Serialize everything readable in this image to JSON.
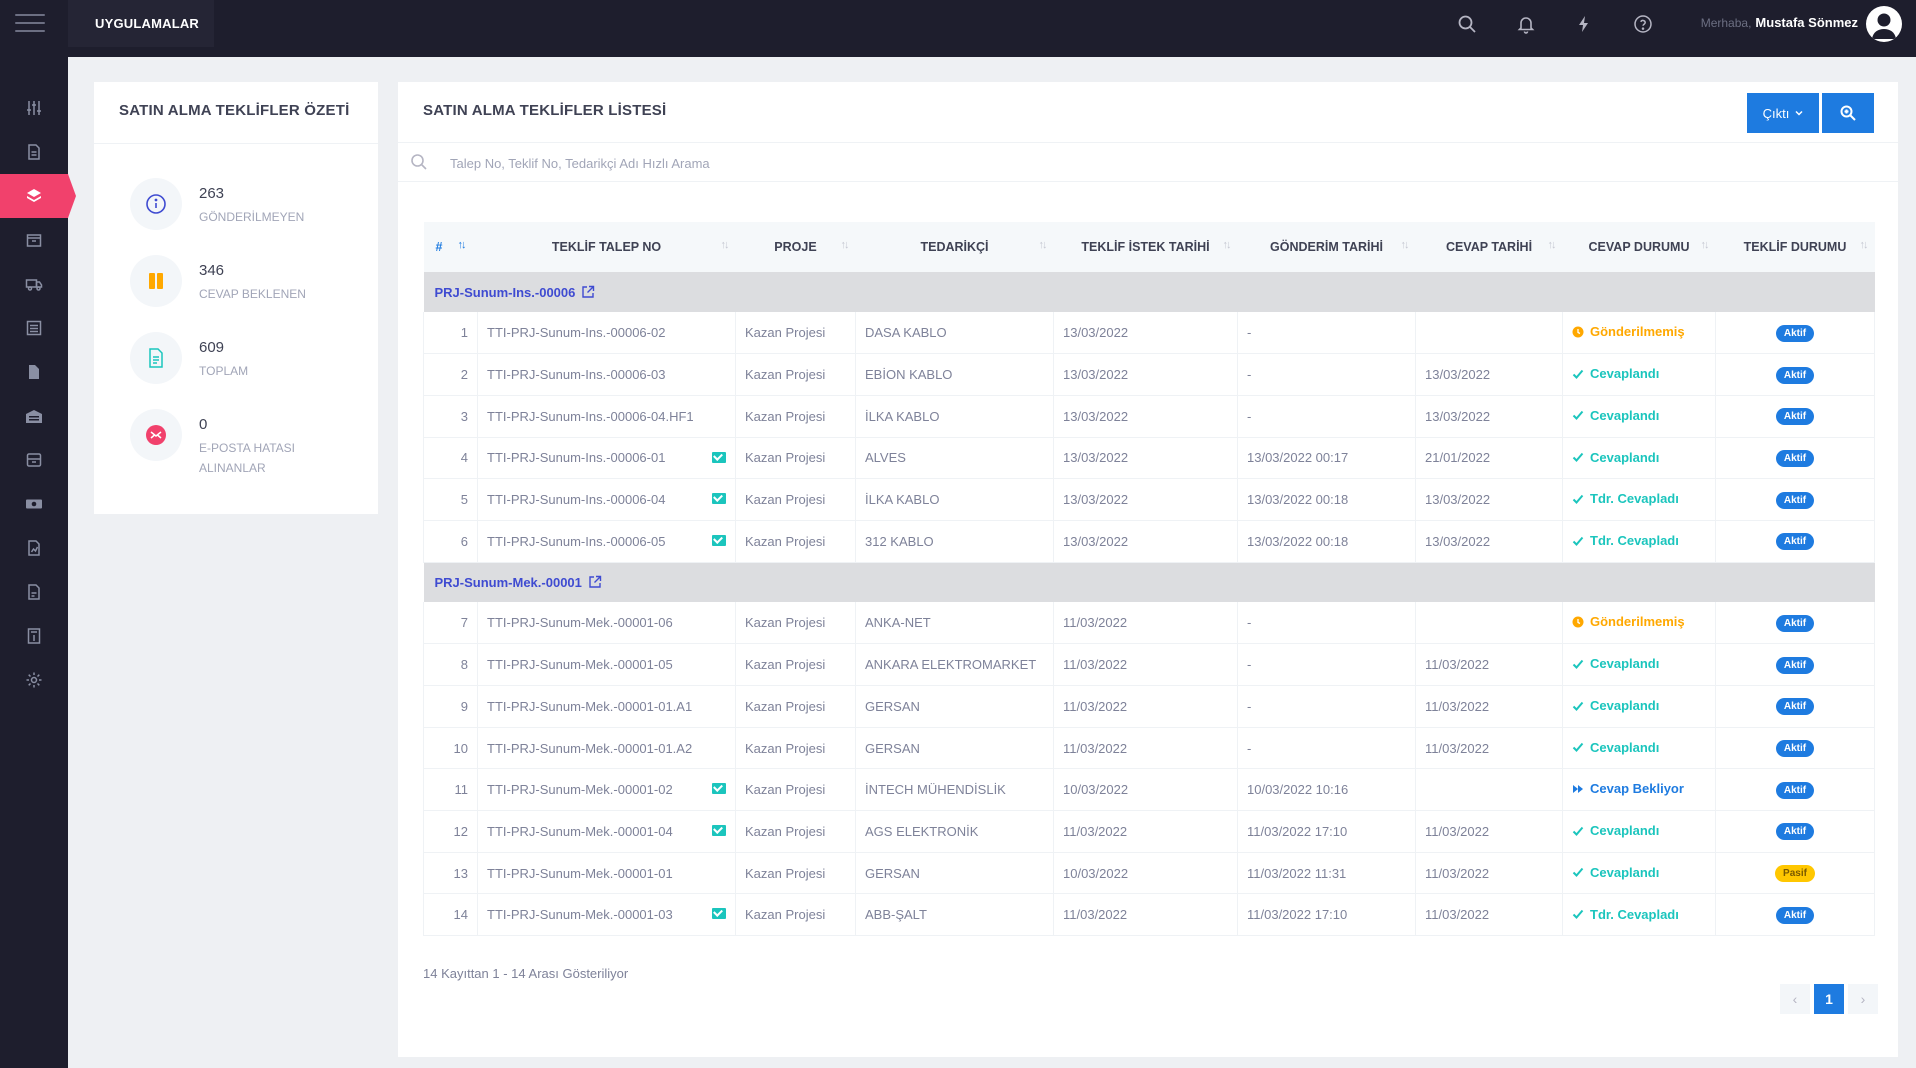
{
  "topbar": {
    "apps_label": "UYGULAMALAR",
    "greeting_prefix": "Merhaba,",
    "user_name": "Mustafa Sönmez"
  },
  "summary": {
    "title": "SATIN ALMA TEKLİFLER ÖZETİ",
    "stats": [
      {
        "value": "263",
        "label": "GÖNDERİLMEYEN",
        "icon": "info-icon",
        "color": "#3f4bd1"
      },
      {
        "value": "346",
        "label": "CEVAP BEKLENEN",
        "icon": "pause-icon",
        "color": "#ffa800"
      },
      {
        "value": "609",
        "label": "TOPLAM",
        "icon": "document-icon",
        "color": "#1bc5bd"
      },
      {
        "value": "0",
        "label": "E-POSTA HATASI ALINANLAR",
        "icon": "mail-error-icon",
        "color": "#f1416c"
      }
    ]
  },
  "list": {
    "title": "SATIN ALMA TEKLİFLER LİSTESİ",
    "output_button": "Çıktı",
    "search_placeholder": "Talep No, Teklif No, Tedarikçi Adı Hızlı Arama",
    "columns": [
      "#",
      "TEKLİF TALEP NO",
      "PROJE",
      "TEDARİKÇİ",
      "TEKLİF İSTEK TARİHİ",
      "GÖNDERİM TARİHİ",
      "CEVAP TARİHİ",
      "CEVAP DURUMU",
      "TEKLİF DURUMU"
    ],
    "groups": [
      {
        "name": "PRJ-Sunum-Ins.-00006",
        "rows": [
          {
            "n": "1",
            "no": "TTI-PRJ-Sunum-Ins.-00006-02",
            "mail": false,
            "project": "Kazan Projesi",
            "supplier": "DASA KABLO",
            "request": "13/03/2022",
            "sent": "-",
            "answer": "",
            "status": "Gönderilmemiş",
            "status_type": "orange",
            "state": "Aktif"
          },
          {
            "n": "2",
            "no": "TTI-PRJ-Sunum-Ins.-00006-03",
            "mail": false,
            "project": "Kazan Projesi",
            "supplier": "EBİON KABLO",
            "request": "13/03/2022",
            "sent": "-",
            "answer": "13/03/2022",
            "status": "Cevaplandı",
            "status_type": "green",
            "state": "Aktif"
          },
          {
            "n": "3",
            "no": "TTI-PRJ-Sunum-Ins.-00006-04.HF1",
            "mail": false,
            "project": "Kazan Projesi",
            "supplier": "İLKA KABLO",
            "request": "13/03/2022",
            "sent": "-",
            "answer": "13/03/2022",
            "status": "Cevaplandı",
            "status_type": "green",
            "state": "Aktif"
          },
          {
            "n": "4",
            "no": "TTI-PRJ-Sunum-Ins.-00006-01",
            "mail": true,
            "project": "Kazan Projesi",
            "supplier": "ALVES",
            "request": "13/03/2022",
            "sent": "13/03/2022 00:17",
            "answer": "21/01/2022",
            "status": "Cevaplandı",
            "status_type": "green",
            "state": "Aktif"
          },
          {
            "n": "5",
            "no": "TTI-PRJ-Sunum-Ins.-00006-04",
            "mail": true,
            "project": "Kazan Projesi",
            "supplier": "İLKA KABLO",
            "request": "13/03/2022",
            "sent": "13/03/2022 00:18",
            "answer": "13/03/2022",
            "status": "Tdr. Cevapladı",
            "status_type": "green",
            "state": "Aktif"
          },
          {
            "n": "6",
            "no": "TTI-PRJ-Sunum-Ins.-00006-05",
            "mail": true,
            "project": "Kazan Projesi",
            "supplier": "312 KABLO",
            "request": "13/03/2022",
            "sent": "13/03/2022 00:18",
            "answer": "13/03/2022",
            "status": "Tdr. Cevapladı",
            "status_type": "green",
            "state": "Aktif"
          }
        ]
      },
      {
        "name": "PRJ-Sunum-Mek.-00001",
        "rows": [
          {
            "n": "7",
            "no": "TTI-PRJ-Sunum-Mek.-00001-06",
            "mail": false,
            "project": "Kazan Projesi",
            "supplier": "ANKA-NET",
            "request": "11/03/2022",
            "sent": "-",
            "answer": "",
            "status": "Gönderilmemiş",
            "status_type": "orange",
            "state": "Aktif"
          },
          {
            "n": "8",
            "no": "TTI-PRJ-Sunum-Mek.-00001-05",
            "mail": false,
            "project": "Kazan Projesi",
            "supplier": "ANKARA ELEKTROMARKET",
            "request": "11/03/2022",
            "sent": "-",
            "answer": "11/03/2022",
            "status": "Cevaplandı",
            "status_type": "green",
            "state": "Aktif"
          },
          {
            "n": "9",
            "no": "TTI-PRJ-Sunum-Mek.-00001-01.A1",
            "mail": false,
            "project": "Kazan Projesi",
            "supplier": "GERSAN",
            "request": "11/03/2022",
            "sent": "-",
            "answer": "11/03/2022",
            "status": "Cevaplandı",
            "status_type": "green",
            "state": "Aktif"
          },
          {
            "n": "10",
            "no": "TTI-PRJ-Sunum-Mek.-00001-01.A2",
            "mail": false,
            "project": "Kazan Projesi",
            "supplier": "GERSAN",
            "request": "11/03/2022",
            "sent": "-",
            "answer": "11/03/2022",
            "status": "Cevaplandı",
            "status_type": "green",
            "state": "Aktif"
          },
          {
            "n": "11",
            "no": "TTI-PRJ-Sunum-Mek.-00001-02",
            "mail": true,
            "project": "Kazan Projesi",
            "supplier": "İNTECH MÜHENDİSLİK",
            "request": "10/03/2022",
            "sent": "10/03/2022 10:16",
            "answer": "",
            "status": "Cevap Bekliyor",
            "status_type": "blue",
            "state": "Aktif"
          },
          {
            "n": "12",
            "no": "TTI-PRJ-Sunum-Mek.-00001-04",
            "mail": true,
            "project": "Kazan Projesi",
            "supplier": "AGS ELEKTRONİK",
            "request": "11/03/2022",
            "sent": "11/03/2022 17:10",
            "answer": "11/03/2022",
            "status": "Cevaplandı",
            "status_type": "green",
            "state": "Aktif"
          },
          {
            "n": "13",
            "no": "TTI-PRJ-Sunum-Mek.-00001-01",
            "mail": false,
            "project": "Kazan Projesi",
            "supplier": "GERSAN",
            "request": "10/03/2022",
            "sent": "11/03/2022 11:31",
            "answer": "11/03/2022",
            "status": "Cevaplandı",
            "status_type": "green",
            "state": "Pasif"
          },
          {
            "n": "14",
            "no": "TTI-PRJ-Sunum-Mek.-00001-03",
            "mail": true,
            "project": "Kazan Projesi",
            "supplier": "ABB-ŞALT",
            "request": "11/03/2022",
            "sent": "11/03/2022 17:10",
            "answer": "11/03/2022",
            "status": "Tdr. Cevapladı",
            "status_type": "green",
            "state": "Aktif"
          }
        ]
      }
    ],
    "footer_info": "14 Kayıttan 1 - 14 Arası Gösteriliyor",
    "current_page": "1"
  },
  "sidebar": {
    "items": [
      "sliders-icon",
      "document-icon",
      "layers-icon",
      "box-icon",
      "truck-icon",
      "list-icon",
      "file-icon",
      "warehouse-icon",
      "archive-icon",
      "money-icon",
      "report-icon",
      "report2-icon",
      "calculator-icon",
      "gear-icon"
    ],
    "active_index": 2
  }
}
